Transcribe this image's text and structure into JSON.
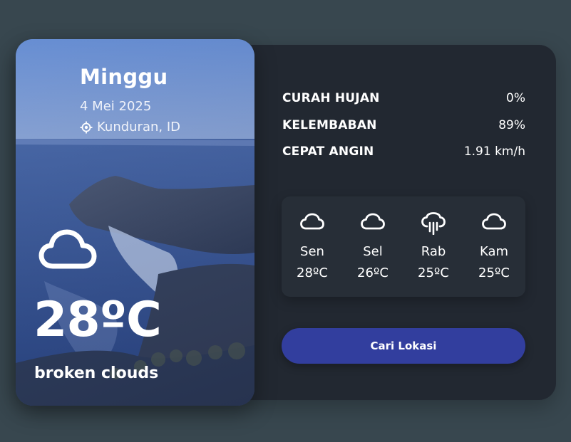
{
  "current": {
    "day": "Minggu",
    "date": "4 Mei 2025",
    "location": "Kunduran, ID",
    "location_icon": "location-crosshair-icon",
    "weather_icon": "cloud-icon",
    "temperature": "28ºC",
    "description": "broken clouds"
  },
  "details": [
    {
      "label": "CURAH HUJAN",
      "value": "0%"
    },
    {
      "label": "KELEMBABAN",
      "value": "89%"
    },
    {
      "label": "CEPAT ANGIN",
      "value": "1.91 km/h"
    }
  ],
  "forecast": [
    {
      "day": "Sen",
      "temp": "28ºC",
      "icon": "cloud-icon"
    },
    {
      "day": "Sel",
      "temp": "26ºC",
      "icon": "cloud-icon"
    },
    {
      "day": "Rab",
      "temp": "25ºC",
      "icon": "cloud-rain-icon"
    },
    {
      "day": "Kam",
      "temp": "25ºC",
      "icon": "cloud-icon"
    }
  ],
  "search_button": "Cari Lokasi",
  "colors": {
    "background": "#38474f",
    "card": "#222831",
    "forecast_panel": "#272e37",
    "button": "#323e9e"
  }
}
